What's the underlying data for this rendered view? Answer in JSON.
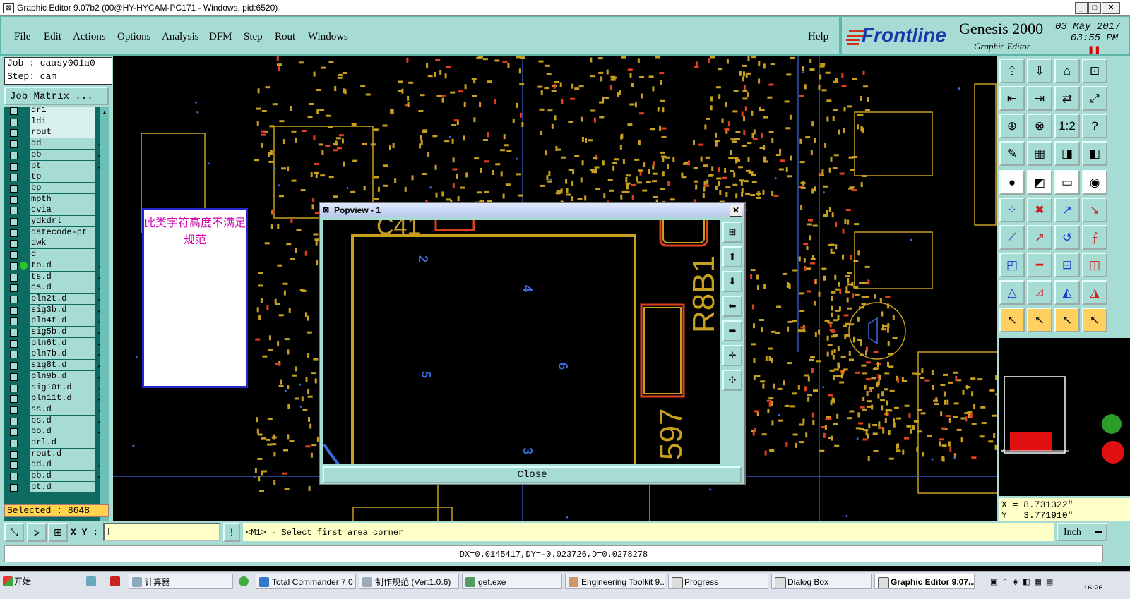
{
  "titlebar": {
    "title": "Graphic Editor 9.07b2 (00@HY-HYCAM-PC171 - Windows, pid:6520)",
    "min": "_",
    "max": "□",
    "close": "✕"
  },
  "menu": {
    "items": [
      "File",
      "Edit",
      "Actions",
      "Options",
      "Analysis",
      "DFM",
      "Step",
      "Rout",
      "Windows"
    ],
    "help": "Help"
  },
  "logo": {
    "brand": "Frontline",
    "product": "Genesis 2000",
    "subtitle": "Graphic Editor",
    "date": "03 May 2017",
    "time": "03:55 PM"
  },
  "job": {
    "job_line": "Job : caasy001a0",
    "step_line": "Step: cam",
    "matrix_button": "Job Matrix ..."
  },
  "layers": [
    {
      "name": "dr1",
      "edit": false,
      "highlight": true
    },
    {
      "name": "ldi",
      "edit": false,
      "highlight": true
    },
    {
      "name": "rout",
      "edit": false,
      "highlight": true
    },
    {
      "name": "dd",
      "edit": true
    },
    {
      "name": "pb",
      "edit": true
    },
    {
      "name": "pt",
      "edit": true
    },
    {
      "name": "tp",
      "edit": false
    },
    {
      "name": "bp",
      "edit": false
    },
    {
      "name": "mpth",
      "edit": false
    },
    {
      "name": "cvia",
      "edit": false
    },
    {
      "name": "ydkdrl",
      "edit": false
    },
    {
      "name": "datecode-pt",
      "edit": false
    },
    {
      "name": "dwk",
      "edit": false
    },
    {
      "name": "d",
      "edit": false
    },
    {
      "name": "to.d",
      "edit": true,
      "active": true
    },
    {
      "name": "ts.d",
      "edit": true
    },
    {
      "name": "cs.d",
      "edit": true
    },
    {
      "name": "pln2t.d",
      "edit": true
    },
    {
      "name": "sig3b.d",
      "edit": true
    },
    {
      "name": "pln4t.d",
      "edit": true
    },
    {
      "name": "sig5b.d",
      "edit": true
    },
    {
      "name": "pln6t.d",
      "edit": true
    },
    {
      "name": "pln7b.d",
      "edit": true
    },
    {
      "name": "sig8t.d",
      "edit": true
    },
    {
      "name": "pln9b.d",
      "edit": true
    },
    {
      "name": "sig10t.d",
      "edit": true
    },
    {
      "name": "pln11t.d",
      "edit": true
    },
    {
      "name": "ss.d",
      "edit": true
    },
    {
      "name": "bs.d",
      "edit": true
    },
    {
      "name": "bo.d",
      "edit": true
    },
    {
      "name": "drl.d",
      "edit": false
    },
    {
      "name": "rout.d",
      "edit": false
    },
    {
      "name": "dd.d",
      "edit": true
    },
    {
      "name": "pb.d",
      "edit": true
    },
    {
      "name": "pt.d",
      "edit": false
    }
  ],
  "selected": "Selected : 8648",
  "note": {
    "text": "此类字符高度不满足规范"
  },
  "popview": {
    "title": "Popview - 1",
    "close_label": "Close",
    "labels": {
      "top_left": "C41",
      "ref": "R8B1",
      "num": "597",
      "pins": [
        "2",
        "4",
        "5",
        "6",
        "3"
      ]
    }
  },
  "coords": {
    "x": "X =  8.731322\"",
    "y": "Y =  3.771910\""
  },
  "command": {
    "xy_label": "X Y :",
    "prompt": "<M1> - Select first area corner",
    "units": "Inch"
  },
  "measure": "DX=0.0145417,DY=-0.023726,D=0.0278278",
  "taskbar": {
    "start": "开始",
    "tasks": [
      "计算器",
      "Total Commander 7.0 ...",
      "制作规范 (Ver:1.0.6)",
      "get.exe",
      "Engineering Toolkit 9....",
      "Progress",
      "Dialog Box",
      "Graphic Editor 9.07..."
    ],
    "clock": "16:26"
  },
  "colors": {
    "panel": "#a7dcd5",
    "pcb_trace": "#c8a020",
    "pcb_pad": "#e04020",
    "pcb_blue": "#3a6ad8"
  }
}
